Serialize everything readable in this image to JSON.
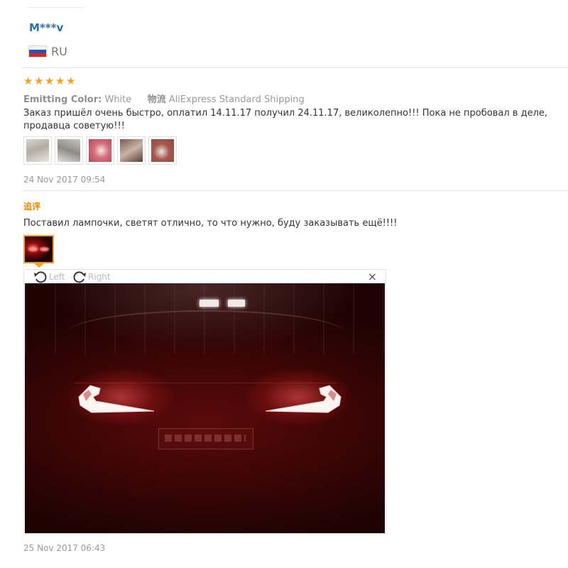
{
  "reviewer": {
    "name": "M***v",
    "country_code": "RU",
    "flag_icon": "russia-flag-icon"
  },
  "review": {
    "rating": 5,
    "star_color": "#f4a21d",
    "attributes": [
      {
        "key": "Emitting Color:",
        "value": "White"
      },
      {
        "key": "物流",
        "value": "AliExpress Standard Shipping"
      }
    ],
    "text": "Заказ пришёл очень быстро, оплатил 14.11.17 получил 24.11.17, великолепно!!! Пока не пробовал в деле, продавца советую!!!",
    "photo_count": 5,
    "date": "24 Nov 2017 09:54"
  },
  "additional_feedback": {
    "label": "追评",
    "label_color": "#f08500",
    "text": "Поставил лампочки, светят отлично, то что нужно, буду заказывать ещё!!!!",
    "date": "25 Nov 2017 06:43"
  },
  "viewer": {
    "rotate_left_label": "Left",
    "rotate_right_label": "Right",
    "close_label": "×",
    "rotate_left_icon": "rotate-left-icon",
    "rotate_right_icon": "rotate-right-icon",
    "close_icon": "close-icon"
  },
  "colors": {
    "username": "#2b6fb6",
    "accent": "#f4a21d",
    "muted_text": "#999999"
  }
}
